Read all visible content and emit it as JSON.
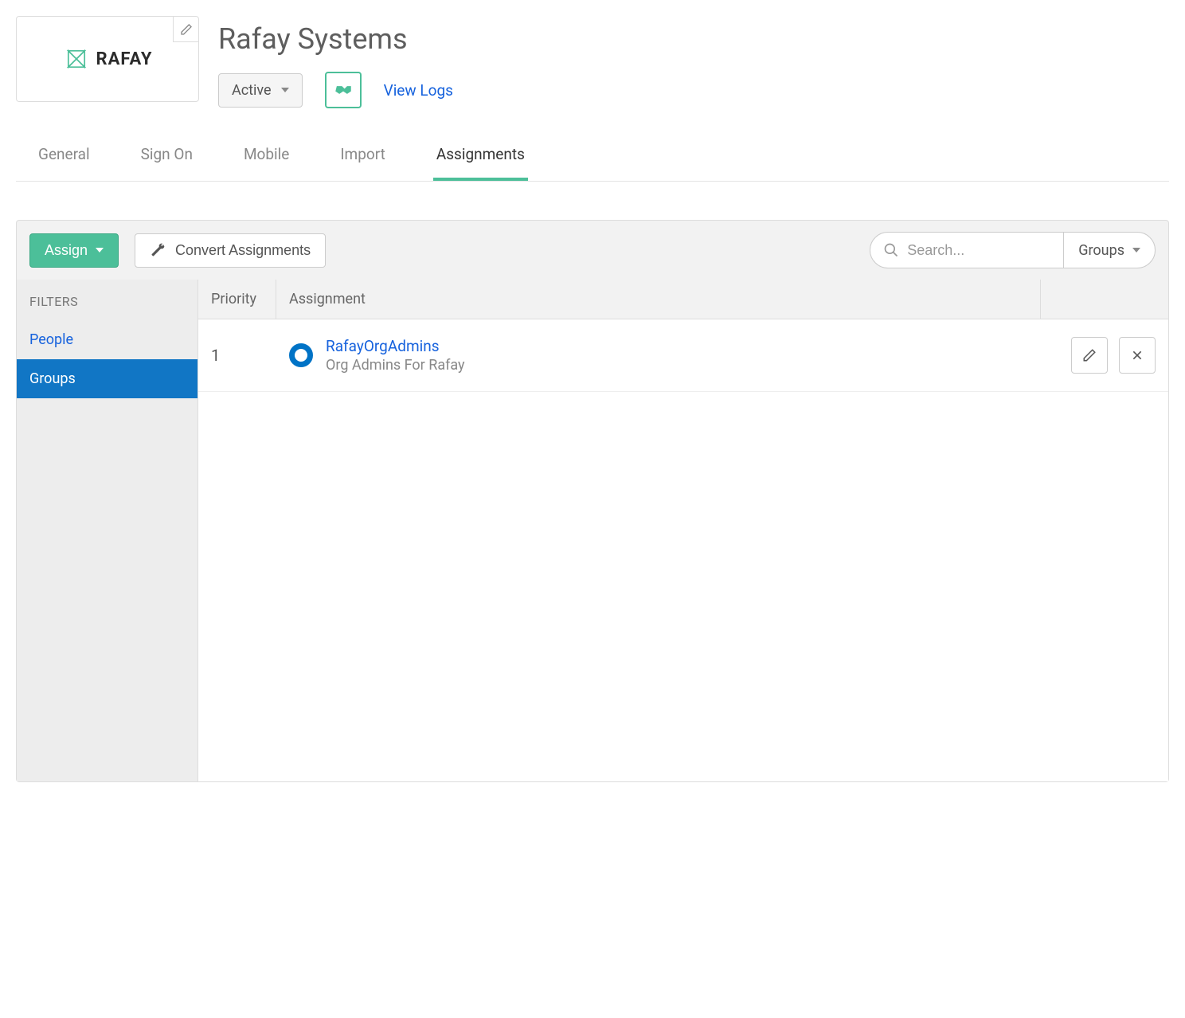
{
  "header": {
    "logo_text": "RAFAY",
    "title": "Rafay Systems",
    "status": "Active",
    "view_logs": "View Logs"
  },
  "tabs": [
    {
      "label": "General",
      "active": false
    },
    {
      "label": "Sign On",
      "active": false
    },
    {
      "label": "Mobile",
      "active": false
    },
    {
      "label": "Import",
      "active": false
    },
    {
      "label": "Assignments",
      "active": true
    }
  ],
  "toolbar": {
    "assign_label": "Assign",
    "convert_label": "Convert Assignments",
    "search_placeholder": "Search...",
    "scope_label": "Groups"
  },
  "filters": {
    "title": "FILTERS",
    "items": [
      {
        "label": "People",
        "active": false
      },
      {
        "label": "Groups",
        "active": true
      }
    ]
  },
  "table": {
    "columns": {
      "priority": "Priority",
      "assignment": "Assignment"
    },
    "rows": [
      {
        "priority": "1",
        "name": "RafayOrgAdmins",
        "desc": "Org Admins For Rafay"
      }
    ]
  }
}
